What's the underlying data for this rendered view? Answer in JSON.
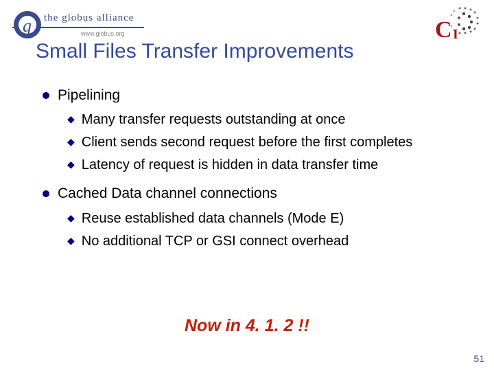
{
  "header": {
    "globus_text": "the globus alliance",
    "globus_url": "www.globus.org",
    "globus_g": "g",
    "ci_c": "C",
    "ci_i": "I"
  },
  "title": "Small Files Transfer Improvements",
  "content": {
    "b1": {
      "label": "Pipelining"
    },
    "b1_sub": {
      "s1": "Many transfer requests outstanding at once",
      "s2": "Client sends second request before the first completes",
      "s3": "Latency of request is hidden in data transfer time"
    },
    "b2": {
      "label": "Cached Data channel connections"
    },
    "b2_sub": {
      "s1": "Reuse established data channels (Mode E)",
      "s2": "No additional TCP or GSI connect overhead"
    }
  },
  "callout": "Now in 4. 1. 2 !!",
  "page_number": "51"
}
